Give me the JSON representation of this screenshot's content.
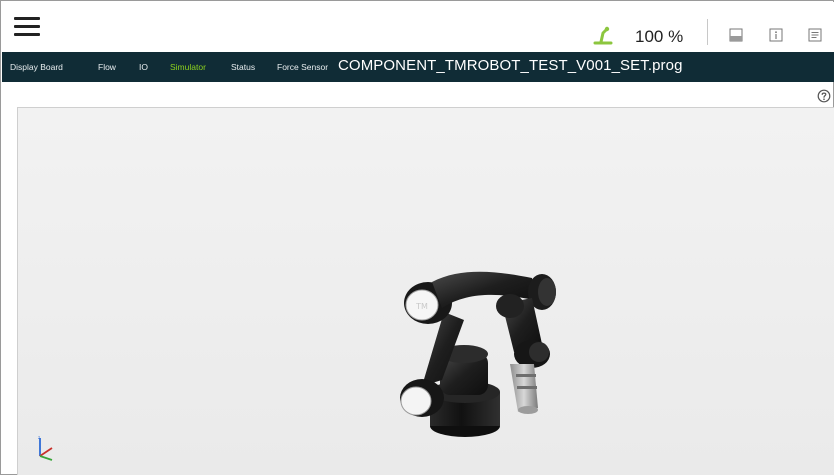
{
  "topbar": {
    "speed": "100 %",
    "icons": [
      "menu-icon",
      "robot-status-icon",
      "display-icon",
      "info-icon",
      "log-icon"
    ]
  },
  "nav": {
    "tabs": [
      {
        "label": "Display Board",
        "active": false
      },
      {
        "label": "Flow",
        "active": false
      },
      {
        "label": "IO",
        "active": false
      },
      {
        "label": "Simulator",
        "active": true
      },
      {
        "label": "Status",
        "active": false
      },
      {
        "label": "Force Sensor",
        "active": false
      }
    ],
    "file_name": "COMPONENT_TMROBOT_TEST_V001_SET.prog"
  },
  "colors": {
    "nav_background": "#102c36",
    "active_tab": "#8cd11e",
    "status_icon": "#8cc63f"
  }
}
